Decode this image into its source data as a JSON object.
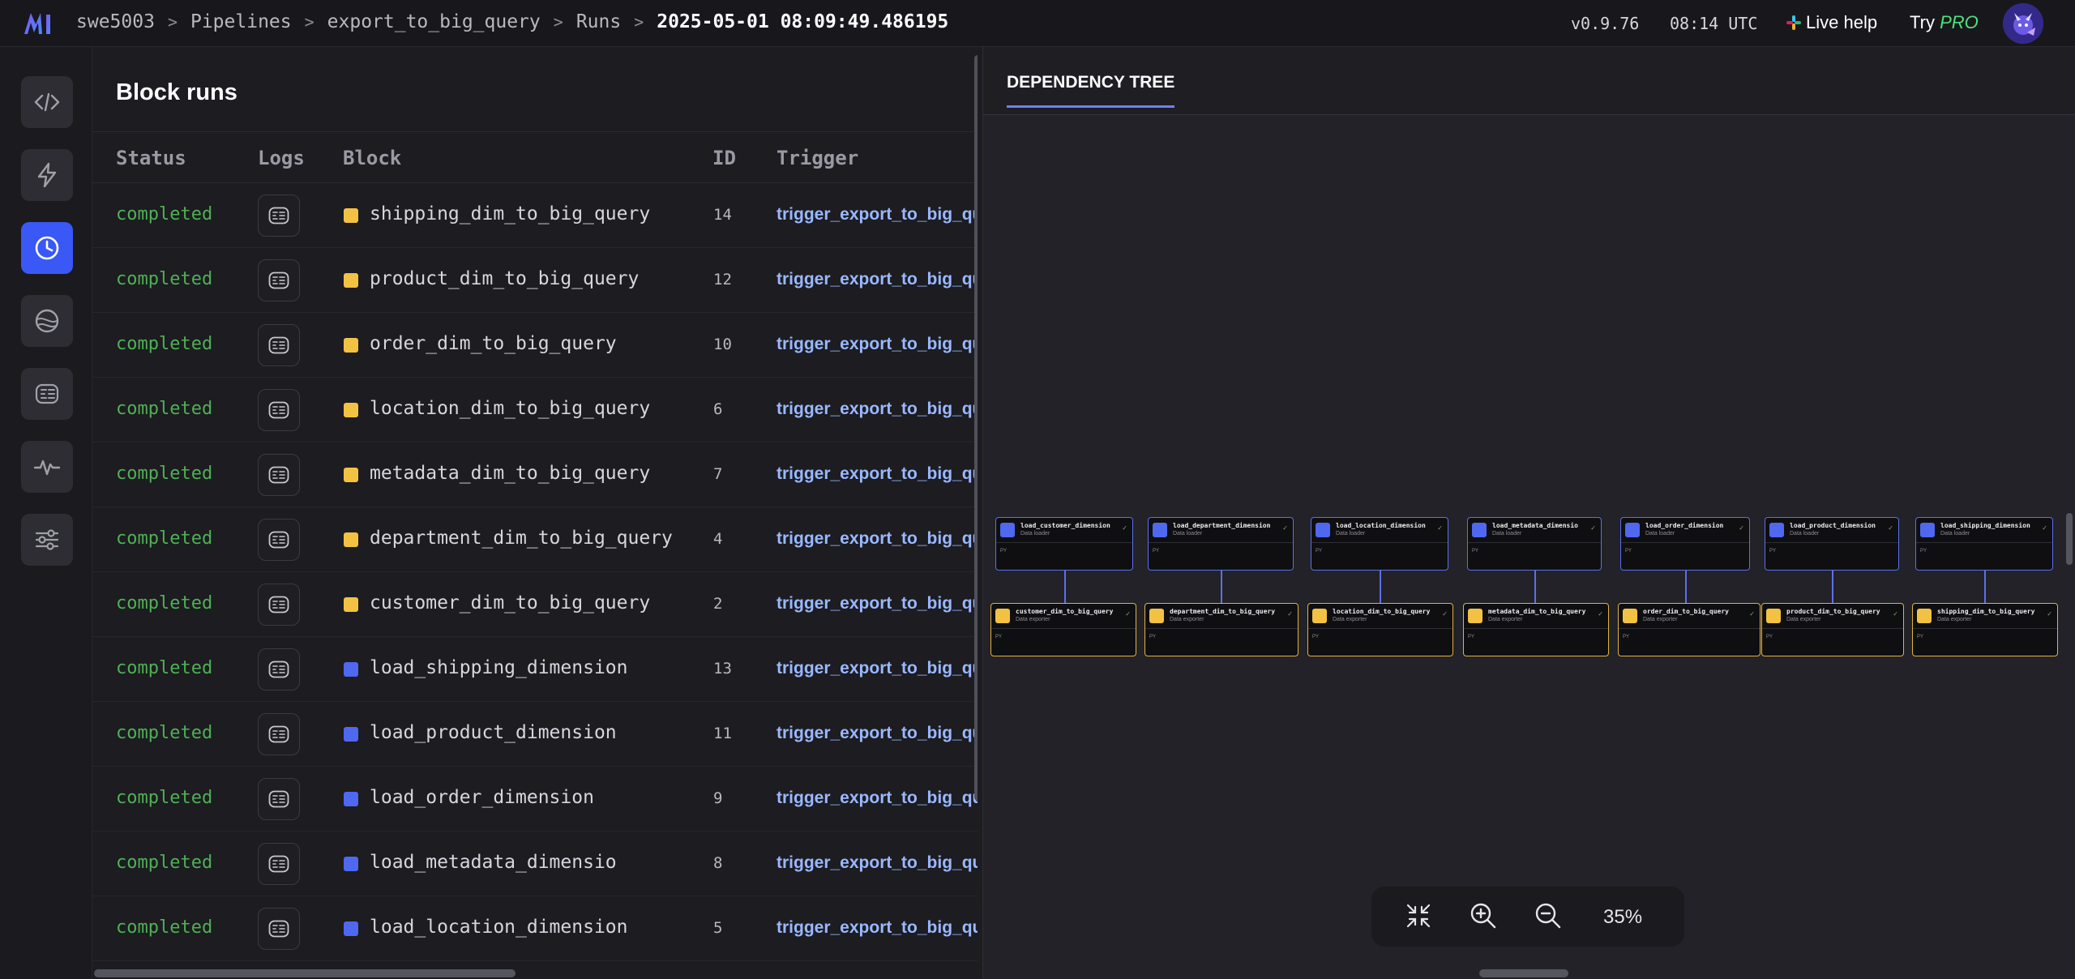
{
  "header": {
    "breadcrumbs": [
      "swe5003",
      "Pipelines",
      "export_to_big_query",
      "Runs",
      "2025-05-01 08:09:49.486195"
    ],
    "version": "v0.9.76",
    "time": "08:14 UTC",
    "live_help": "Live help",
    "try_label": "Try",
    "pro_label": "PRO"
  },
  "sidebar": {
    "items": [
      {
        "icon": "code-icon",
        "active": false
      },
      {
        "icon": "lightning-icon",
        "active": false
      },
      {
        "icon": "clock-icon",
        "active": true
      },
      {
        "icon": "globe-icon",
        "active": false
      },
      {
        "icon": "terminal-icon",
        "active": false
      },
      {
        "icon": "activity-icon",
        "active": false
      },
      {
        "icon": "sliders-icon",
        "active": false
      }
    ]
  },
  "block_runs": {
    "title": "Block runs",
    "columns": [
      "Status",
      "Logs",
      "Block",
      "ID",
      "Trigger"
    ],
    "rows": [
      {
        "status": "completed",
        "block": "shipping_dim_to_big_query",
        "kind": "exporter",
        "id": "14",
        "trigger": "trigger_export_to_big_qu"
      },
      {
        "status": "completed",
        "block": "product_dim_to_big_query",
        "kind": "exporter",
        "id": "12",
        "trigger": "trigger_export_to_big_qu"
      },
      {
        "status": "completed",
        "block": "order_dim_to_big_query",
        "kind": "exporter",
        "id": "10",
        "trigger": "trigger_export_to_big_qu"
      },
      {
        "status": "completed",
        "block": "location_dim_to_big_query",
        "kind": "exporter",
        "id": "6",
        "trigger": "trigger_export_to_big_qu"
      },
      {
        "status": "completed",
        "block": "metadata_dim_to_big_query",
        "kind": "exporter",
        "id": "7",
        "trigger": "trigger_export_to_big_qu"
      },
      {
        "status": "completed",
        "block": "department_dim_to_big_query",
        "kind": "exporter",
        "id": "4",
        "trigger": "trigger_export_to_big_qu"
      },
      {
        "status": "completed",
        "block": "customer_dim_to_big_query",
        "kind": "exporter",
        "id": "2",
        "trigger": "trigger_export_to_big_qu"
      },
      {
        "status": "completed",
        "block": "load_shipping_dimension",
        "kind": "loader",
        "id": "13",
        "trigger": "trigger_export_to_big_qu"
      },
      {
        "status": "completed",
        "block": "load_product_dimension",
        "kind": "loader",
        "id": "11",
        "trigger": "trigger_export_to_big_qu"
      },
      {
        "status": "completed",
        "block": "load_order_dimension",
        "kind": "loader",
        "id": "9",
        "trigger": "trigger_export_to_big_qu"
      },
      {
        "status": "completed",
        "block": "load_metadata_dimensio",
        "kind": "loader",
        "id": "8",
        "trigger": "trigger_export_to_big_qu"
      },
      {
        "status": "completed",
        "block": "load_location_dimension",
        "kind": "loader",
        "id": "5",
        "trigger": "trigger_export_to_big_qu"
      }
    ]
  },
  "colors": {
    "loader": "#4f68ef",
    "exporter": "#f3c243",
    "status_completed": "#4fb054",
    "accent": "#3a58f5",
    "trigger": "#9ab8ff"
  },
  "dependency_tree": {
    "tab": "DEPENDENCY TREE",
    "loaders": [
      {
        "name": "load_customer_dimension",
        "type": "Data loader",
        "lang": "PY"
      },
      {
        "name": "load_department_dimension",
        "type": "Data loader",
        "lang": "PY"
      },
      {
        "name": "load_location_dimension",
        "type": "Data loader",
        "lang": "PY"
      },
      {
        "name": "load_metadata_dimensio",
        "type": "Data loader",
        "lang": "PY"
      },
      {
        "name": "load_order_dimension",
        "type": "Data loader",
        "lang": "PY"
      },
      {
        "name": "load_product_dimension",
        "type": "Data loader",
        "lang": "PY"
      },
      {
        "name": "load_shipping_dimension",
        "type": "Data loader",
        "lang": "PY"
      }
    ],
    "exporters": [
      {
        "name": "customer_dim_to_big_query",
        "type": "Data exporter",
        "lang": "PY"
      },
      {
        "name": "department_dim_to_big_query",
        "type": "Data exporter",
        "lang": "PY"
      },
      {
        "name": "location_dim_to_big_query",
        "type": "Data exporter",
        "lang": "PY"
      },
      {
        "name": "metadata_dim_to_big_query",
        "type": "Data exporter",
        "lang": "PY"
      },
      {
        "name": "order_dim_to_big_query",
        "type": "Data exporter",
        "lang": "PY"
      },
      {
        "name": "product_dim_to_big_query",
        "type": "Data exporter",
        "lang": "PY"
      },
      {
        "name": "shipping_dim_to_big_query",
        "type": "Data exporter",
        "lang": "PY"
      }
    ],
    "zoom": "35%"
  }
}
